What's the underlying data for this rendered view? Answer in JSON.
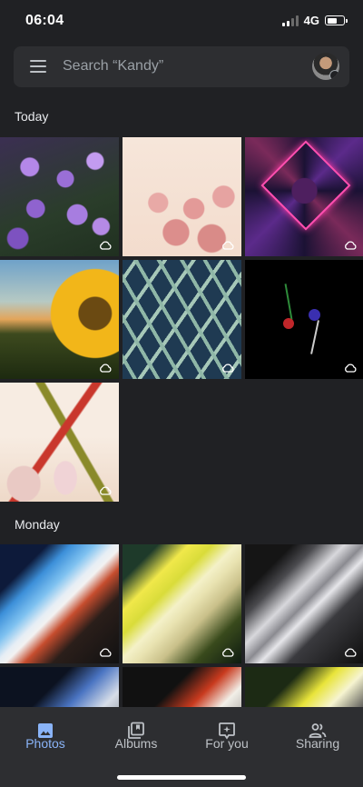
{
  "status_bar": {
    "time": "06:04",
    "network": "4G"
  },
  "search": {
    "placeholder": "Search “Kandy”"
  },
  "sections": [
    {
      "title": "Today",
      "photo_count": 7
    },
    {
      "title": "Monday",
      "photo_count": 6
    }
  ],
  "bottom_nav": {
    "items": [
      {
        "label": "Photos",
        "icon": "photos-icon",
        "active": true
      },
      {
        "label": "Albums",
        "icon": "albums-icon",
        "active": false
      },
      {
        "label": "For you",
        "icon": "for-you-icon",
        "active": false
      },
      {
        "label": "Sharing",
        "icon": "sharing-icon",
        "active": false
      }
    ]
  },
  "colors": {
    "background": "#202124",
    "surface": "#2d2e31",
    "accent": "#8ab4f8",
    "text": "#e8eaed"
  }
}
